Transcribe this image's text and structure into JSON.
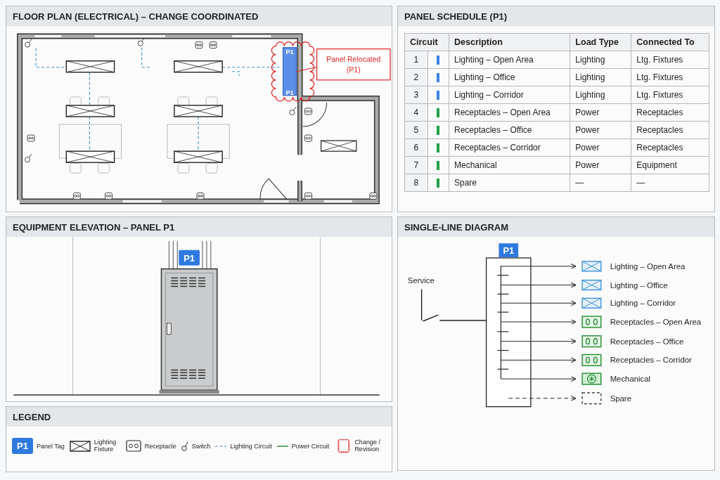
{
  "floor_plan": {
    "title": "FLOOR PLAN (ELECTRICAL) – CHANGE COORDINATED",
    "panel_tags": [
      "P1",
      "P1"
    ],
    "callout_lines": [
      "Panel Relocated",
      "(P1)"
    ]
  },
  "schedule": {
    "title": "PANEL SCHEDULE (P1)",
    "columns": [
      "Circuit",
      "Description",
      "Load Type",
      "Connected To"
    ],
    "rows": [
      {
        "circuit": "1",
        "color": "#3b82e6",
        "description": "Lighting – Open Area",
        "load_type": "Lighting",
        "connected_to": "Ltg. Fixtures"
      },
      {
        "circuit": "2",
        "color": "#3b82e6",
        "description": "Lighting – Office",
        "load_type": "Lighting",
        "connected_to": "Ltg. Fixtures"
      },
      {
        "circuit": "3",
        "color": "#3b82e6",
        "description": "Lighting – Corridor",
        "load_type": "Lighting",
        "connected_to": "Ltg. Fixtures"
      },
      {
        "circuit": "4",
        "color": "#22a045",
        "description": "Receptacles – Open Area",
        "load_type": "Power",
        "connected_to": "Receptacles"
      },
      {
        "circuit": "5",
        "color": "#22a045",
        "description": "Receptacles – Office",
        "load_type": "Power",
        "connected_to": "Receptacles"
      },
      {
        "circuit": "6",
        "color": "#22a045",
        "description": "Receptacles – Corridor",
        "load_type": "Power",
        "connected_to": "Receptacles"
      },
      {
        "circuit": "7",
        "color": "#22a045",
        "description": "Mechanical",
        "load_type": "Power",
        "connected_to": "Equipment"
      },
      {
        "circuit": "8",
        "color": "#22a045",
        "description": "Spare",
        "load_type": "—",
        "connected_to": "—"
      }
    ]
  },
  "elevation": {
    "title": "EQUIPMENT ELEVATION – PANEL P1",
    "panel_tag": "P1"
  },
  "single_line": {
    "title": "SINGLE-LINE DIAGRAM",
    "panel_tag": "P1",
    "service_label": "Service",
    "loads": [
      {
        "kind": "lighting",
        "label": "Lighting – Open Area"
      },
      {
        "kind": "lighting",
        "label": "Lighting – Office"
      },
      {
        "kind": "lighting",
        "label": "Lighting – Corridor"
      },
      {
        "kind": "receptacle",
        "label": "Receptacles – Open Area"
      },
      {
        "kind": "receptacle",
        "label": "Receptacles – Office"
      },
      {
        "kind": "receptacle",
        "label": "Receptacles – Corridor"
      },
      {
        "kind": "mechanical",
        "label": "Mechanical"
      },
      {
        "kind": "spare",
        "label": "Spare"
      }
    ]
  },
  "legend": {
    "title": "LEGEND",
    "items": [
      {
        "kind": "panel_tag",
        "symbol": "P1",
        "label": "Panel Tag"
      },
      {
        "kind": "fixture",
        "label": "Lighting Fixture"
      },
      {
        "kind": "receptacle",
        "label": "Receptacle"
      },
      {
        "kind": "switch",
        "label": "Switch"
      },
      {
        "kind": "lighting_circuit",
        "label": "Lighting Circuit"
      },
      {
        "kind": "power_circuit",
        "label": "Power Circuit"
      },
      {
        "kind": "revision",
        "label": "Change / Revision"
      }
    ]
  }
}
